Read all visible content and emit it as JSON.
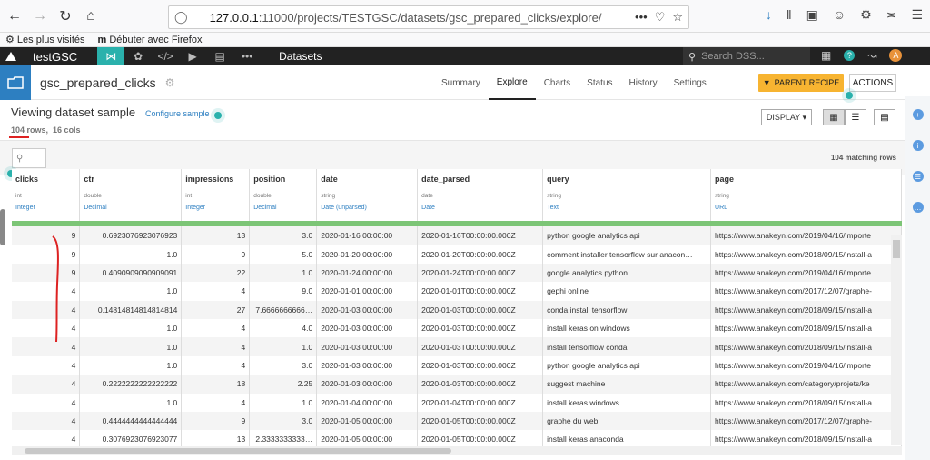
{
  "browser": {
    "url_prefix": "127.0.0.1",
    "url_rest": ":11000/projects/TESTGSC/datasets/gsc_prepared_clicks/explore/",
    "bookmarks": [
      "Les plus visités",
      "Débuter avec Firefox"
    ]
  },
  "topbar": {
    "project": "testGSC",
    "section": "Datasets",
    "search_placeholder": "Search DSS...",
    "avatar_letter": "A",
    "help_glyph": "?"
  },
  "dataset": {
    "name": "gsc_prepared_clicks",
    "tabs": [
      "Summary",
      "Explore",
      "Charts",
      "Status",
      "History",
      "Settings"
    ],
    "active_tab": "Explore",
    "parent_recipe": "PARENT RECIPE",
    "actions": "ACTIONS"
  },
  "sample": {
    "viewing": "Viewing dataset sample",
    "configure": "Configure sample",
    "rows": "104 rows,",
    "cols": "16 cols",
    "display": "DISPLAY ▾",
    "matching": "104 matching rows"
  },
  "table": {
    "columns": [
      {
        "name": "clicks",
        "type": "int",
        "meaning": "Integer"
      },
      {
        "name": "ctr",
        "type": "double",
        "meaning": "Decimal"
      },
      {
        "name": "impressions",
        "type": "int",
        "meaning": "Integer"
      },
      {
        "name": "position",
        "type": "double",
        "meaning": "Decimal"
      },
      {
        "name": "date",
        "type": "string",
        "meaning": "Date (unparsed)"
      },
      {
        "name": "date_parsed",
        "type": "date",
        "meaning": "Date"
      },
      {
        "name": "query",
        "type": "string",
        "meaning": "Text"
      },
      {
        "name": "page",
        "type": "string",
        "meaning": "URL"
      }
    ],
    "rows": [
      [
        "9",
        "0.6923076923076923",
        "13",
        "3.0",
        "2020-01-16 00:00:00",
        "2020-01-16T00:00:00.000Z",
        "python google analytics api",
        "https://www.anakeyn.com/2019/04/16/importe"
      ],
      [
        "9",
        "1.0",
        "9",
        "5.0",
        "2020-01-20 00:00:00",
        "2020-01-20T00:00:00.000Z",
        "comment installer tensorflow sur anacon…",
        "https://www.anakeyn.com/2018/09/15/install-a"
      ],
      [
        "9",
        "0.4090909090909091",
        "22",
        "1.0",
        "2020-01-24 00:00:00",
        "2020-01-24T00:00:00.000Z",
        "google analytics python",
        "https://www.anakeyn.com/2019/04/16/importe"
      ],
      [
        "4",
        "1.0",
        "4",
        "9.0",
        "2020-01-01 00:00:00",
        "2020-01-01T00:00:00.000Z",
        "gephi online",
        "https://www.anakeyn.com/2017/12/07/graphe-"
      ],
      [
        "4",
        "0.14814814814814814",
        "27",
        "7.6666666666…",
        "2020-01-03 00:00:00",
        "2020-01-03T00:00:00.000Z",
        "conda install tensorflow",
        "https://www.anakeyn.com/2018/09/15/install-a"
      ],
      [
        "4",
        "1.0",
        "4",
        "4.0",
        "2020-01-03 00:00:00",
        "2020-01-03T00:00:00.000Z",
        "install keras on windows",
        "https://www.anakeyn.com/2018/09/15/install-a"
      ],
      [
        "4",
        "1.0",
        "4",
        "1.0",
        "2020-01-03 00:00:00",
        "2020-01-03T00:00:00.000Z",
        "install tensorflow conda",
        "https://www.anakeyn.com/2018/09/15/install-a"
      ],
      [
        "4",
        "1.0",
        "4",
        "3.0",
        "2020-01-03 00:00:00",
        "2020-01-03T00:00:00.000Z",
        "python google analytics api",
        "https://www.anakeyn.com/2019/04/16/importe"
      ],
      [
        "4",
        "0.2222222222222222",
        "18",
        "2.25",
        "2020-01-03 00:00:00",
        "2020-01-03T00:00:00.000Z",
        "suggest machine",
        "https://www.anakeyn.com/category/projets/ke"
      ],
      [
        "4",
        "1.0",
        "4",
        "1.0",
        "2020-01-04 00:00:00",
        "2020-01-04T00:00:00.000Z",
        "install keras windows",
        "https://www.anakeyn.com/2018/09/15/install-a"
      ],
      [
        "4",
        "0.4444444444444444",
        "9",
        "3.0",
        "2020-01-05 00:00:00",
        "2020-01-05T00:00:00.000Z",
        "graphe du web",
        "https://www.anakeyn.com/2017/12/07/graphe-"
      ],
      [
        "4",
        "0.3076923076923077",
        "13",
        "2.3333333333…",
        "2020-01-05 00:00:00",
        "2020-01-05T00:00:00.000Z",
        "install keras anaconda",
        "https://www.anakeyn.com/2018/09/15/install-a"
      ]
    ]
  }
}
